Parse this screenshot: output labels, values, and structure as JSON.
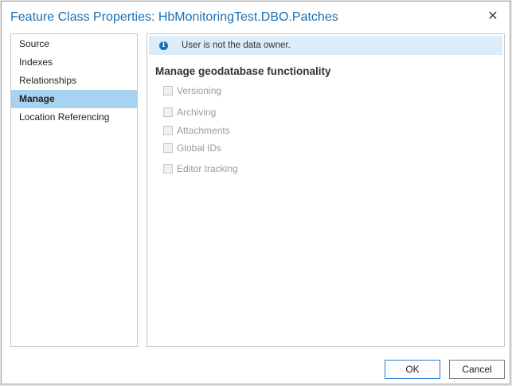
{
  "window": {
    "title": "Feature Class Properties: HbMonitoringTest.DBO.Patches",
    "close_icon": "close-icon"
  },
  "sidebar": {
    "items": [
      {
        "label": "Source",
        "selected": false
      },
      {
        "label": "Indexes",
        "selected": false
      },
      {
        "label": "Relationships",
        "selected": false
      },
      {
        "label": "Manage",
        "selected": true
      },
      {
        "label": "Location Referencing",
        "selected": false
      }
    ]
  },
  "main": {
    "info_message": "User is not the data owner.",
    "info_icon": "info-icon",
    "section_title": "Manage geodatabase functionality",
    "options": [
      {
        "label": "Versioning",
        "checked": false,
        "enabled": false
      },
      {
        "label": "Archiving",
        "checked": false,
        "enabled": false
      },
      {
        "label": "Attachments",
        "checked": false,
        "enabled": false
      },
      {
        "label": "Global IDs",
        "checked": false,
        "enabled": false
      },
      {
        "label": "Editor tracking",
        "checked": false,
        "enabled": false
      }
    ]
  },
  "footer": {
    "ok_label": "OK",
    "cancel_label": "Cancel"
  },
  "colors": {
    "title": "#1a6fb5",
    "selected_item": "#a8d2f2",
    "info_bar": "#dcecf8"
  }
}
